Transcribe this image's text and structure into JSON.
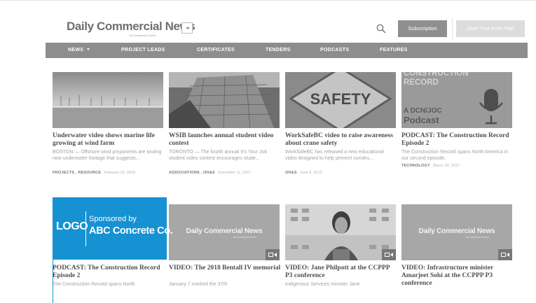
{
  "header": {
    "site_name": "Daily Commercial News",
    "site_tagline": "by ConstructConnect",
    "subscription_label": "Subscription",
    "trial_label": "Start Your Free Trial"
  },
  "nav": {
    "items": [
      {
        "label": "NEWS",
        "has_dropdown": true
      },
      {
        "label": "PROJECT LEADS"
      },
      {
        "label": "CERTIFICATES"
      },
      {
        "label": "TENDERS"
      },
      {
        "label": "PODCASTS"
      },
      {
        "label": "FEATURES"
      }
    ]
  },
  "cards": [
    {
      "title": "Underwater video shows marine life growing at wind farm",
      "excerpt": "BOSTON — Offshore wind proponents are touting new underwater footage that suggests...",
      "category": "PROJECTS , RESOURCE",
      "date": "February 20, 2018",
      "thumb": "wind-farm-photo"
    },
    {
      "title": "WSIB launches annual student video contest",
      "excerpt": "TORONTO — The fourth annual It's Your Job student video contest encourages stude...",
      "category": "ASSOCIATIONS , OH&S",
      "date": "December 11, 2017",
      "thumb": "building-photo"
    },
    {
      "title": "WorkSafeBC video to raise awareness about crane safety",
      "excerpt": "WorkSafeBC has released a new educational video designed to help prevent constru...",
      "category": "OH&S",
      "date": "June 8, 2010",
      "thumb": "safety-sign",
      "thumb_text": "SAFETY"
    },
    {
      "title": "PODCAST: The Construction Record Episode 2",
      "excerpt": "The Construction Record spans North America in our second episode.",
      "category": "TECHNOLOGY",
      "date": "March 30, 2017",
      "thumb": "podcast-art",
      "thumb_lines": [
        "CONSTRUCTION",
        "RECORD",
        "A DCN/JOC",
        "Podcast"
      ]
    },
    {
      "title": "PODCAST: The Construction Record Episode 2",
      "excerpt": "The Construction Record spans North",
      "thumb": "hidden-by-sponsor"
    },
    {
      "title": "VIDEO: The 2018 Bentall IV memorial",
      "excerpt": "January 7 marked the 37th",
      "thumb": "dcn-placeholder"
    },
    {
      "title": "VIDEO: Jane Philpott at the CCPPP P3 conference",
      "excerpt": "Indigenous Services minister Jane",
      "thumb": "speaker-photo"
    },
    {
      "title": "VIDEO: Infrastructure minister Amarjeet Sohi at the CCPPP P3 conference",
      "excerpt": "",
      "thumb": "dcn-placeholder"
    }
  ],
  "placeholder": {
    "name": "Daily Commercial News",
    "tagline": "by ConstructConnect"
  },
  "sponsor": {
    "logo_text": "LOGO",
    "sponsored_by": "Sponsored by",
    "company": "ABC Concrete Co.",
    "background_color": "#1691d2"
  },
  "colors": {
    "nav_bg": "#8d8d8d",
    "subscription_bg": "#8f8f8f",
    "trial_bg": "#dcdcdc"
  }
}
